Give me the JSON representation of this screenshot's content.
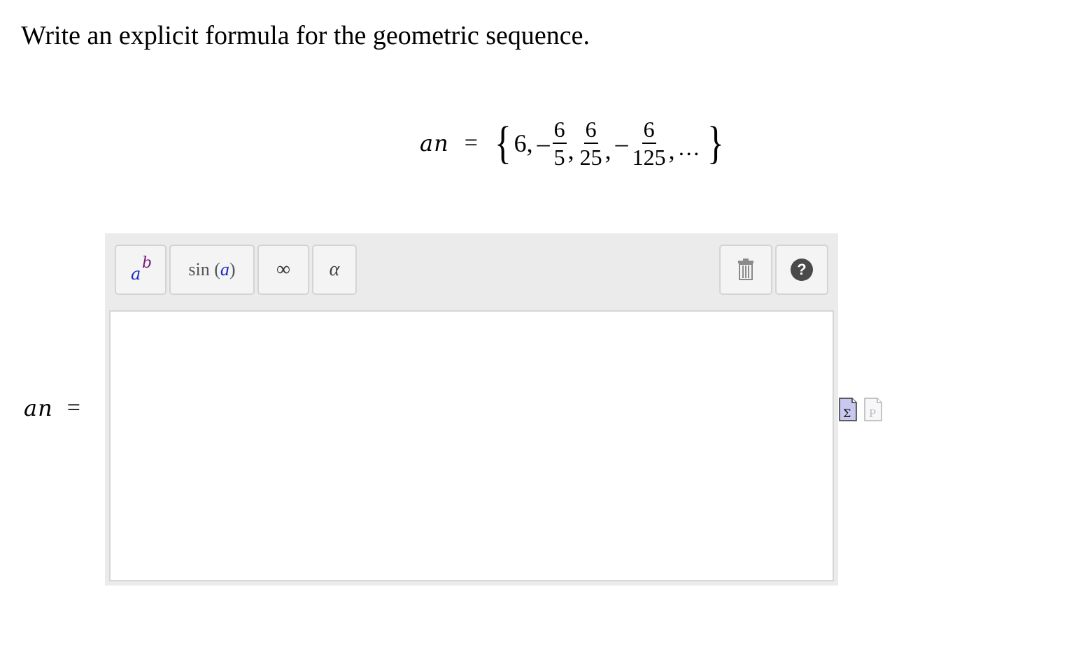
{
  "prompt": "Write an explicit formula for the geometric sequence.",
  "sequence": {
    "lhs_var": "an",
    "equals": "=",
    "open_brace": "{",
    "first_term": "6",
    "comma": ",",
    "minus": "–",
    "frac1_num": "6",
    "frac1_den": "5",
    "frac2_num": "6",
    "frac2_den": "25",
    "frac3_num": "6",
    "frac3_den": "125",
    "ellipsis": "…",
    "close_brace": "}"
  },
  "toolbar": {
    "power_base": "a",
    "power_exp": "b",
    "sin_label": "sin",
    "sin_open": "(",
    "sin_arg": "a",
    "sin_close": ")",
    "infinity": "∞",
    "alpha": "α",
    "help": "?"
  },
  "answer": {
    "label_var": "an",
    "equals": "=",
    "value": ""
  },
  "icons": {
    "trash": "trash-icon",
    "help": "help-icon",
    "sigma": "sigma-icon",
    "plain_text": "document-p-icon"
  }
}
